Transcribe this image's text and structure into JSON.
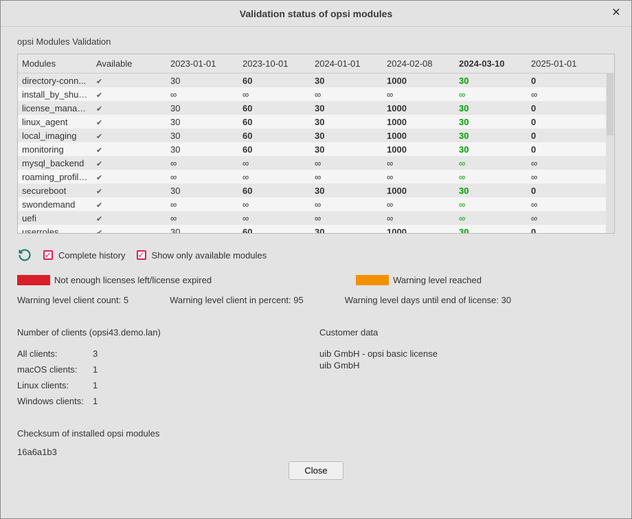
{
  "title": "Validation status of opsi modules",
  "section_title": "opsi Modules Validation",
  "table": {
    "headers": {
      "modules": "Modules",
      "available": "Available",
      "dates": [
        "2023-01-01",
        "2023-10-01",
        "2024-01-01",
        "2024-02-08",
        "2024-03-10",
        "2025-01-01"
      ],
      "current_index": 4
    },
    "rows": [
      {
        "name": "directory-conn...",
        "avail": true,
        "vals": [
          "30",
          "60",
          "30",
          "1000",
          "30",
          "0"
        ],
        "inf": false
      },
      {
        "name": "install_by_shut...",
        "avail": true,
        "vals": [
          "∞",
          "∞",
          "∞",
          "∞",
          "∞",
          "∞"
        ],
        "inf": true
      },
      {
        "name": "license_manag...",
        "avail": true,
        "vals": [
          "30",
          "60",
          "30",
          "1000",
          "30",
          "0"
        ],
        "inf": false
      },
      {
        "name": "linux_agent",
        "avail": true,
        "vals": [
          "30",
          "60",
          "30",
          "1000",
          "30",
          "0"
        ],
        "inf": false
      },
      {
        "name": "local_imaging",
        "avail": true,
        "vals": [
          "30",
          "60",
          "30",
          "1000",
          "30",
          "0"
        ],
        "inf": false
      },
      {
        "name": "monitoring",
        "avail": true,
        "vals": [
          "30",
          "60",
          "30",
          "1000",
          "30",
          "0"
        ],
        "inf": false
      },
      {
        "name": "mysql_backend",
        "avail": true,
        "vals": [
          "∞",
          "∞",
          "∞",
          "∞",
          "∞",
          "∞"
        ],
        "inf": true
      },
      {
        "name": "roaming_profiles",
        "avail": true,
        "vals": [
          "∞",
          "∞",
          "∞",
          "∞",
          "∞",
          "∞"
        ],
        "inf": true
      },
      {
        "name": "secureboot",
        "avail": true,
        "vals": [
          "30",
          "60",
          "30",
          "1000",
          "30",
          "0"
        ],
        "inf": false
      },
      {
        "name": "swondemand",
        "avail": true,
        "vals": [
          "∞",
          "∞",
          "∞",
          "∞",
          "∞",
          "∞"
        ],
        "inf": true
      },
      {
        "name": "uefi",
        "avail": true,
        "vals": [
          "∞",
          "∞",
          "∞",
          "∞",
          "∞",
          "∞"
        ],
        "inf": true
      },
      {
        "name": "userroles",
        "avail": true,
        "vals": [
          "30",
          "60",
          "30",
          "1000",
          "30",
          "0"
        ],
        "inf": false
      }
    ]
  },
  "controls": {
    "complete_history": "Complete history",
    "show_only_available": "Show only available modules"
  },
  "legend": {
    "red": "Not enough licenses left/license expired",
    "orange": "Warning level reached"
  },
  "warnings": {
    "count": "Warning level client count: 5",
    "percent": "Warning level client in percent: 95",
    "days": "Warning level days until end of license: 30"
  },
  "clients": {
    "header": "Number of clients (opsi43.demo.lan)",
    "items": [
      {
        "label": "All clients:",
        "value": "3"
      },
      {
        "label": "macOS clients:",
        "value": "1"
      },
      {
        "label": "Linux clients:",
        "value": "1"
      },
      {
        "label": "Windows clients:",
        "value": "1"
      }
    ]
  },
  "customer": {
    "header": "Customer data",
    "lines": [
      "uib GmbH - opsi basic license",
      "uib GmbH"
    ]
  },
  "checksum": {
    "label": "Checksum of installed opsi modules",
    "value": "16a6a1b3"
  },
  "close_label": "Close"
}
